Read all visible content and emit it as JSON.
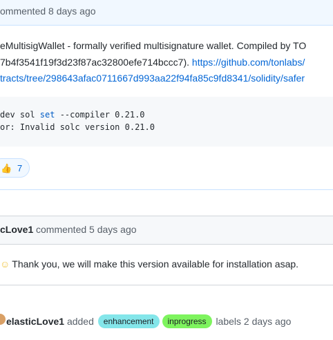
{
  "comment1": {
    "header_text": "ommented 8 days ago",
    "body": {
      "line1": "eMultisigWallet - formally verified multisignature wallet. Compiled by TO",
      "line2_plain": "7b4f3541f19f3d23f87ac32800efe714bccc7). ",
      "line2_link": "https://github.com/tonlabs/",
      "line3_link": "tracts/tree/298643afac0711667d993aa22f94fa85c9fd8341/solidity/safer"
    },
    "code": {
      "line1_pre": "dev sol ",
      "line1_kw": "set",
      "line1_post": " --compiler 0.21.0",
      "line2": "or: Invalid solc version 0.21.0"
    },
    "reaction": {
      "emoji": "👍",
      "icon": "thumbs-up-icon",
      "count": "7"
    }
  },
  "comment2": {
    "author": "cLove1",
    "meta": "commented 5 days ago",
    "body": "Thank you, we will make this version available for installation asap."
  },
  "event": {
    "actor": "elasticLove1",
    "action": "added",
    "labels": [
      {
        "name": "enhancement",
        "color": "#84e6ea"
      },
      {
        "name": "inprogress",
        "color": "#7ef45e"
      }
    ],
    "suffix": "labels 2 days ago"
  }
}
